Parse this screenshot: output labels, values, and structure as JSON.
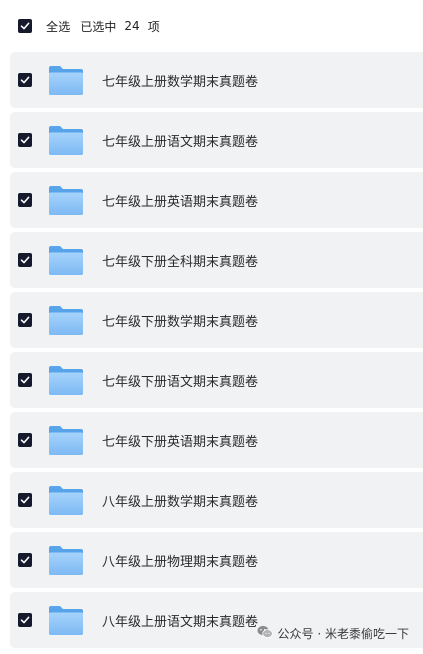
{
  "header": {
    "select_all_label": "全选",
    "selected_prefix": "已选中",
    "selected_count": "24",
    "selected_suffix": "项"
  },
  "items": [
    {
      "name": "七年级上册数学期末真题卷",
      "checked": true
    },
    {
      "name": "七年级上册语文期末真题卷",
      "checked": true
    },
    {
      "name": "七年级上册英语期末真题卷",
      "checked": true
    },
    {
      "name": "七年级下册全科期末真题卷",
      "checked": true
    },
    {
      "name": "七年级下册数学期末真题卷",
      "checked": true
    },
    {
      "name": "七年级下册语文期末真题卷",
      "checked": true
    },
    {
      "name": "七年级下册英语期末真题卷",
      "checked": true
    },
    {
      "name": "八年级上册数学期末真题卷",
      "checked": true
    },
    {
      "name": "八年级上册物理期末真题卷",
      "checked": true
    },
    {
      "name": "八年级上册语文期末真题卷",
      "checked": true
    }
  ],
  "watermark": {
    "text": "公众号 · 米老黍偷吃一下",
    "icon": "wechat-icon"
  },
  "colors": {
    "checkbox": "#151a2d",
    "row_background": "#f1f2f4",
    "folder_blue": "#7cb9f5"
  }
}
